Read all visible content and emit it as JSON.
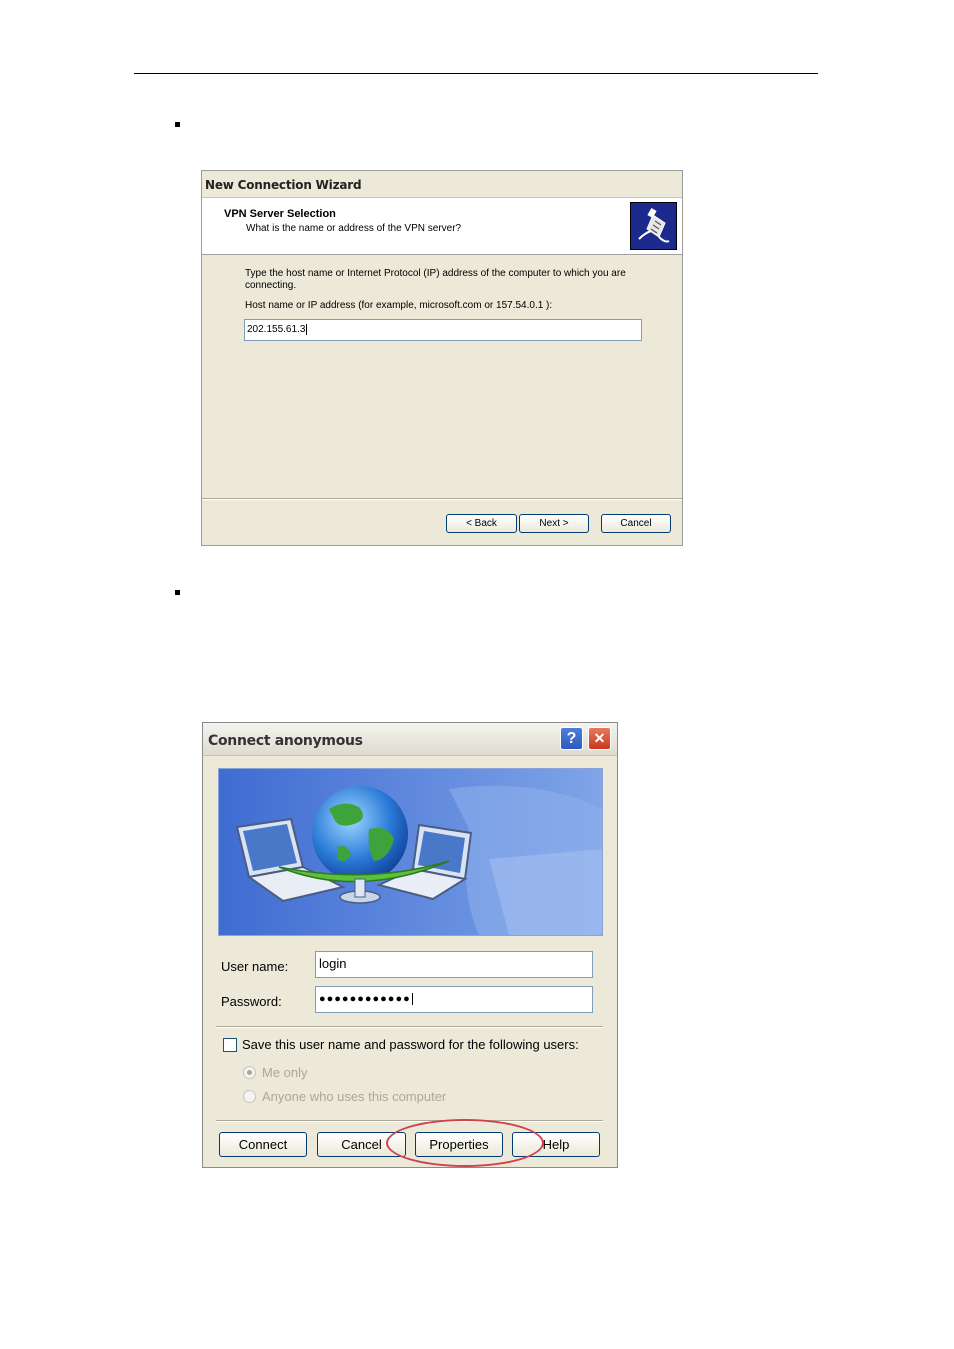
{
  "wizard": {
    "title": "New Connection Wizard",
    "header_title": "VPN Server Selection",
    "header_subtitle": "What is the name or address of the VPN server?",
    "body_text": "Type the host name or Internet Protocol (IP) address of the computer to which you are connecting.",
    "hint": "Host name or IP address (for example, microsoft.com or 157.54.0.1 ):",
    "host_value": "202.155.61.3",
    "buttons": {
      "back": "< Back",
      "next": "Next >",
      "cancel": "Cancel"
    },
    "icon": "vpn-connector-icon"
  },
  "connect_dialog": {
    "title": "Connect anonymous",
    "help_glyph": "?",
    "close_glyph": "✕",
    "user_label": "User name:",
    "user_value": "login",
    "password_label": "Password:",
    "password_value": "●●●●●●●●●●●●",
    "save_label": "Save this user name and password for the following users:",
    "option_me": "Me only",
    "option_anyone": "Anyone who uses this computer",
    "buttons": {
      "connect": "Connect",
      "cancel": "Cancel",
      "properties": "Properties",
      "help": "Help"
    },
    "banner_icon": "network-globe-laptops-icon",
    "highlight_color": "#d0404e"
  }
}
